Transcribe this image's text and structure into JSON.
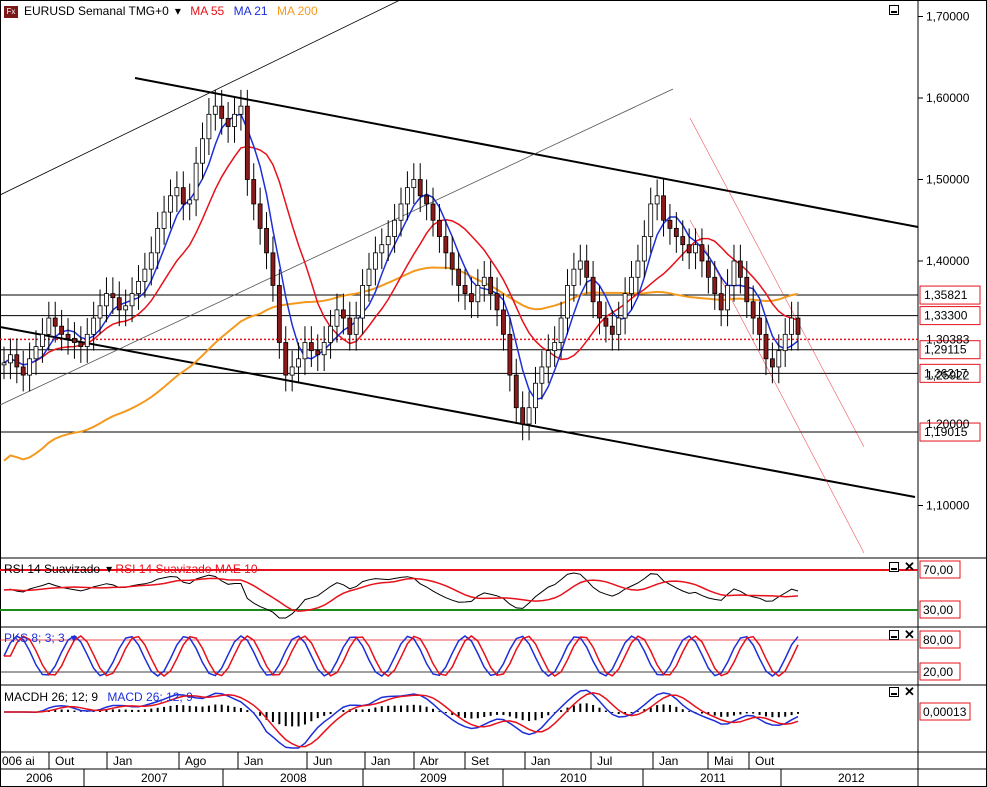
{
  "header": {
    "symbol": "EURUSD Semanal TMG+0",
    "ma1": "MA 55",
    "ma2": "MA 21",
    "ma3": "MA 200",
    "colors": {
      "ma55": "#e8101a",
      "ma21": "#1c2fd8",
      "ma200": "#f39a1e"
    }
  },
  "chart_data": [
    {
      "type": "candlestick",
      "price_ticks": [
        "1,70000",
        "1,60000",
        "1,50000",
        "1,40000",
        "1,10000"
      ],
      "hlines": [
        "1,35821",
        "1,33300",
        "1,29115",
        "1,26217",
        "1,19015"
      ],
      "partial_labels": [
        "1,30383",
        "1,25922",
        "1,20000"
      ],
      "months": [
        "Out",
        "Jan",
        "Ago",
        "Jan",
        "Jun",
        "Jan",
        "Abr",
        "Set",
        "Jan",
        "Jul",
        "Jan",
        "Mai",
        "Out"
      ],
      "month_partial": "006 ai",
      "years": [
        "2006",
        "2007",
        "2008",
        "2009",
        "2010",
        "2011",
        "2012"
      ],
      "series": [
        {
          "name": "MA 21",
          "color": "#1c2fd8"
        },
        {
          "name": "MA 55",
          "color": "#e8101a"
        },
        {
          "name": "MA 200",
          "color": "#f39a1e"
        }
      ],
      "close": [
        1.275,
        1.285,
        1.27,
        1.26,
        1.28,
        1.295,
        1.31,
        1.33,
        1.32,
        1.31,
        1.305,
        1.3,
        1.295,
        1.31,
        1.33,
        1.345,
        1.36,
        1.355,
        1.34,
        1.345,
        1.36,
        1.375,
        1.39,
        1.41,
        1.44,
        1.46,
        1.48,
        1.49,
        1.47,
        1.475,
        1.52,
        1.55,
        1.58,
        1.59,
        1.575,
        1.565,
        1.58,
        1.59,
        1.5,
        1.47,
        1.44,
        1.41,
        1.37,
        1.3,
        1.26,
        1.27,
        1.28,
        1.3,
        1.29,
        1.285,
        1.3,
        1.32,
        1.34,
        1.33,
        1.31,
        1.33,
        1.37,
        1.39,
        1.41,
        1.42,
        1.43,
        1.45,
        1.47,
        1.49,
        1.5,
        1.48,
        1.47,
        1.45,
        1.43,
        1.41,
        1.39,
        1.37,
        1.36,
        1.35,
        1.37,
        1.38,
        1.36,
        1.34,
        1.31,
        1.26,
        1.22,
        1.2,
        1.22,
        1.25,
        1.27,
        1.29,
        1.3,
        1.33,
        1.37,
        1.39,
        1.4,
        1.38,
        1.35,
        1.33,
        1.32,
        1.31,
        1.33,
        1.36,
        1.38,
        1.4,
        1.43,
        1.47,
        1.48,
        1.45,
        1.44,
        1.43,
        1.42,
        1.41,
        1.42,
        1.4,
        1.38,
        1.36,
        1.34,
        1.37,
        1.4,
        1.38,
        1.35,
        1.33,
        1.31,
        1.28,
        1.27,
        1.29,
        1.31,
        1.33,
        1.31
      ],
      "osc": {
        "rsi": {
          "name": "RSI 14 Suavizado",
          "signal_name": "RSI 14 Suavizado MAE 10",
          "levels": [
            "70,00",
            "30,00"
          ]
        },
        "pks": {
          "name": "PKS 8; 3; 3",
          "levels": [
            "80,00",
            "20,00"
          ]
        },
        "macd": {
          "name": "MACDH 26; 12; 9",
          "signal_name": "MACD 26; 12; 9",
          "value": "0,00013"
        }
      }
    }
  ]
}
